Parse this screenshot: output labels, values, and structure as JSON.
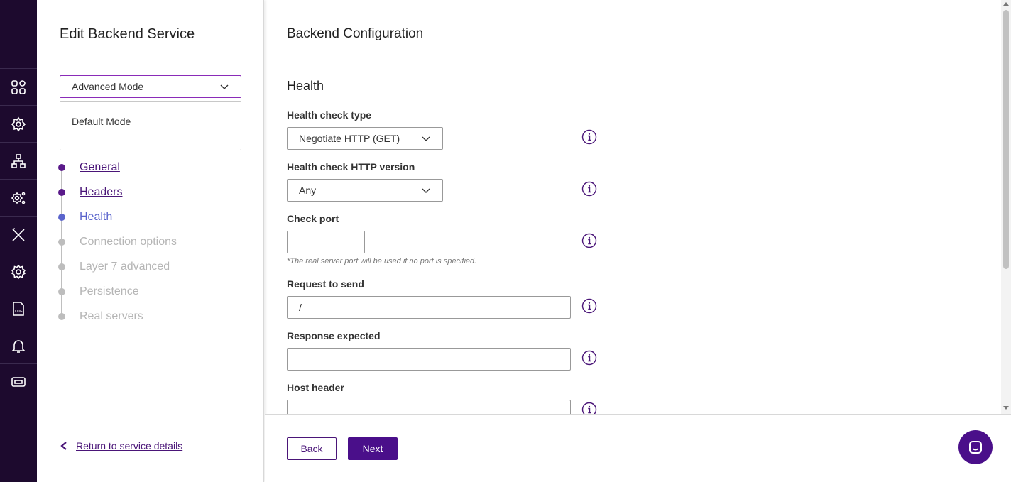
{
  "panel": {
    "title": "Edit Backend Service",
    "mode_select": {
      "value": "Advanced Mode"
    },
    "mode_options": [
      "Default Mode"
    ],
    "steps": [
      {
        "label": "General",
        "state": "done"
      },
      {
        "label": "Headers",
        "state": "done"
      },
      {
        "label": "Health",
        "state": "active"
      },
      {
        "label": "Connection options",
        "state": "todo"
      },
      {
        "label": "Layer 7 advanced",
        "state": "todo"
      },
      {
        "label": "Persistence",
        "state": "todo"
      },
      {
        "label": "Real servers",
        "state": "todo"
      }
    ],
    "return_link": "Return to service details"
  },
  "rail": {
    "icons": [
      "dashboard-icon",
      "cluster-gear-icon",
      "network-icon",
      "services-gear-icon",
      "tools-icon",
      "settings-icon",
      "log-file-icon",
      "bell-icon",
      "ticket-icon"
    ],
    "log_icon_text": "LOG"
  },
  "main": {
    "title": "Backend Configuration",
    "section": "Health",
    "fields": {
      "health_check_type": {
        "label": "Health check type",
        "value": "Negotiate HTTP (GET)"
      },
      "http_version": {
        "label": "Health check HTTP version",
        "value": "Any"
      },
      "check_port": {
        "label": "Check port",
        "value": "",
        "hint": "*The real server port will be used if no port is specified."
      },
      "request_to_send": {
        "label": "Request to send",
        "value": "/"
      },
      "response_expected": {
        "label": "Response expected",
        "value": ""
      },
      "host_header": {
        "label": "Host header",
        "value": ""
      }
    }
  },
  "footer": {
    "back_label": "Back",
    "next_label": "Next"
  },
  "colors": {
    "rail_bg": "#1d0a2e",
    "accent": "#4a0f8a",
    "active_step": "#5a64cc"
  }
}
